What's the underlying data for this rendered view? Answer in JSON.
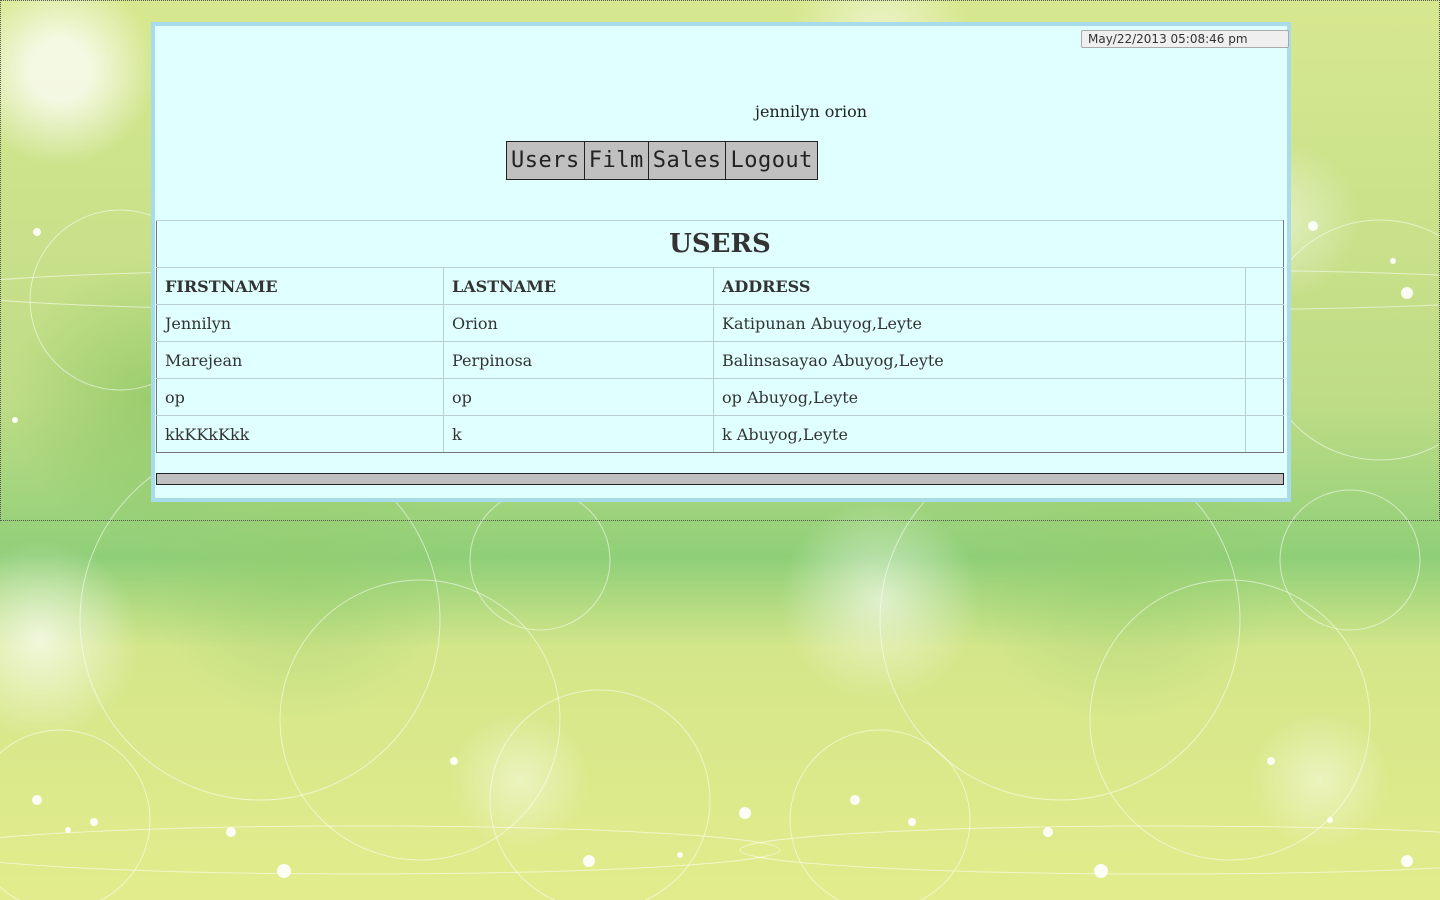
{
  "header": {
    "datetime": "May/22/2013 05:08:46 pm",
    "username": "jennilyn orion"
  },
  "nav": {
    "items": [
      {
        "label": "Users"
      },
      {
        "label": "Film"
      },
      {
        "label": "Sales"
      },
      {
        "label": "Logout"
      }
    ]
  },
  "table": {
    "title": "USERS",
    "columns": [
      "FIRSTNAME",
      "LASTNAME",
      "ADDRESS"
    ],
    "rows": [
      [
        "Jennilyn",
        "Orion",
        "Katipunan Abuyog,Leyte"
      ],
      [
        "Marejean",
        "Perpinosa",
        "Balinsasayao Abuyog,Leyte"
      ],
      [
        "op",
        "op",
        "op Abuyog,Leyte"
      ],
      [
        "kkKKkKkk",
        "k",
        "k Abuyog,Leyte"
      ]
    ]
  },
  "colors": {
    "panel_background": "#e0ffff",
    "panel_border": "#a9dcea",
    "nav_button": "#c0c0c0",
    "page_background": "#cfe28c"
  }
}
